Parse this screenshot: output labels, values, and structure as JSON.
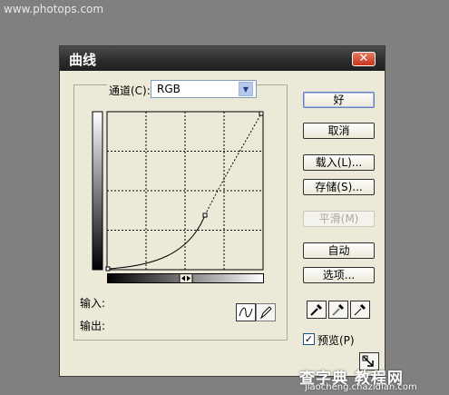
{
  "watermark_top": "www.photops.com",
  "window": {
    "title": "曲线",
    "close": "✕"
  },
  "channel": {
    "label": "通道(C):",
    "value": "RGB"
  },
  "buttons": {
    "ok": "好",
    "cancel": "取消",
    "load": "载入(L)...",
    "save": "存储(S)...",
    "smooth": "平滑(M)",
    "auto": "自动",
    "options": "选项..."
  },
  "readouts": {
    "input_label": "输入:",
    "output_label": "输出:"
  },
  "preview": {
    "label": "预览(P)",
    "checked": true
  },
  "watermark_bottom": {
    "main": "查字典 教程网",
    "sub": "jiaocheng.chazidian.com"
  }
}
